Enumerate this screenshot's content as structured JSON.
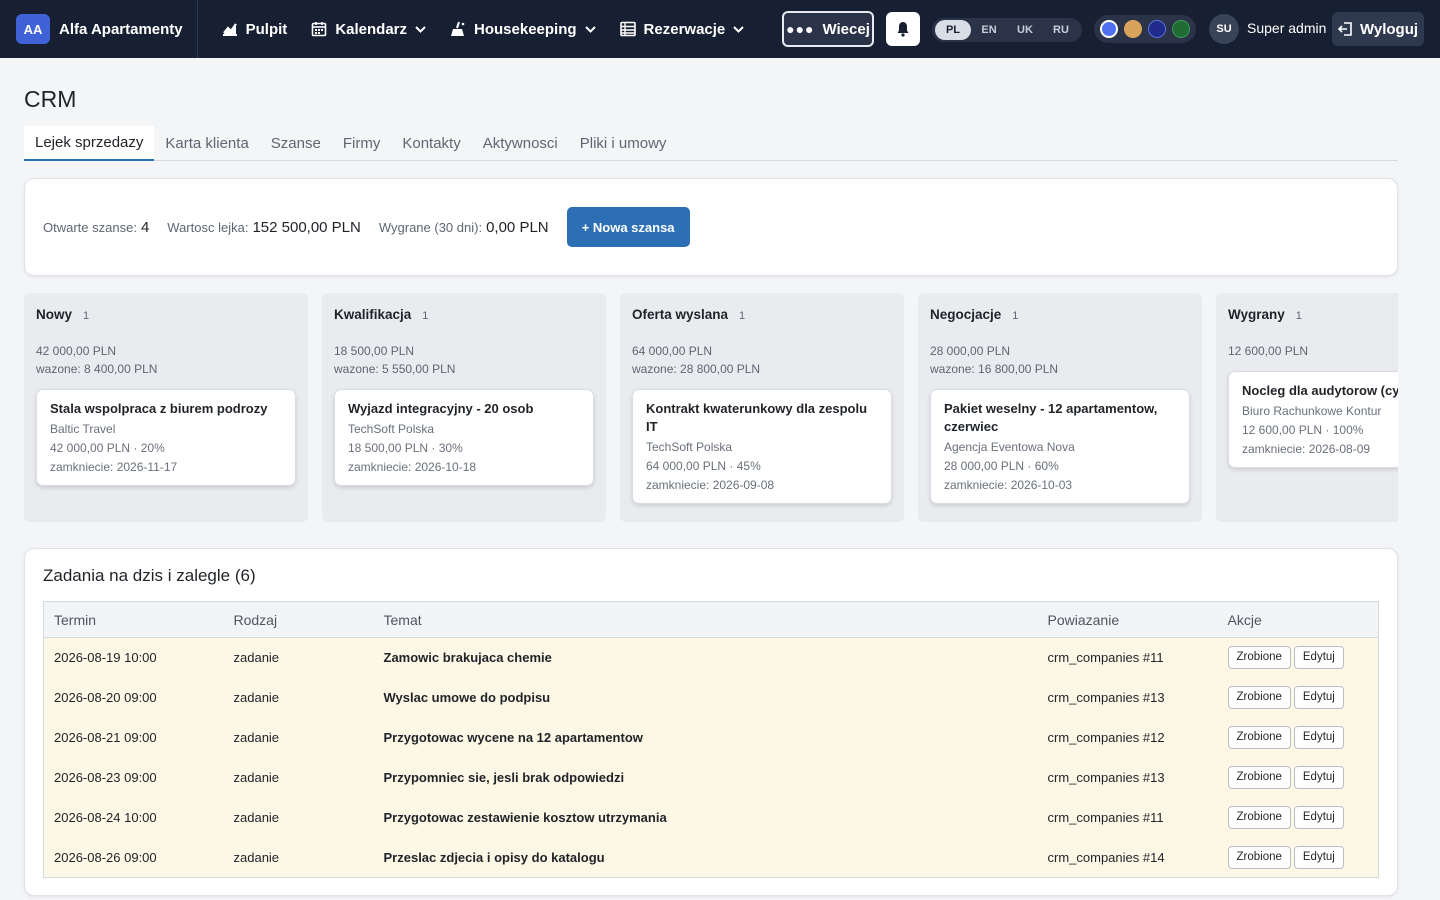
{
  "nav": {
    "brand_badge": "AA",
    "brand_name": "Alfa Apartamenty",
    "items": [
      {
        "label": "Pulpit",
        "icon": "chart-icon"
      },
      {
        "label": "Kalendarz",
        "icon": "calendar-icon"
      },
      {
        "label": "Housekeeping",
        "icon": "broom-icon"
      },
      {
        "label": "Rezerwacje",
        "icon": "list-icon"
      }
    ],
    "more_label": "Wiecej",
    "languages": [
      "PL",
      "EN",
      "UK",
      "RU"
    ],
    "active_language": "PL",
    "theme_colors": [
      "#4f6ff0",
      "#d9a35c",
      "#1f2a8a",
      "#1e6b34"
    ],
    "user_initials": "SU",
    "user_name": "Super admin",
    "logout_label": "Wyloguj"
  },
  "page": {
    "title": "CRM",
    "tabs": [
      "Lejek sprzedazy",
      "Karta klienta",
      "Szanse",
      "Firmy",
      "Kontakty",
      "Aktywnosci",
      "Pliki i umowy"
    ],
    "active_tab": "Lejek sprzedazy"
  },
  "stats": {
    "open_label": "Otwarte szanse:",
    "open_value": "4",
    "funnel_label": "Wartosc lejka:",
    "funnel_value": "152 500,00 PLN",
    "won_label": "Wygrane (30 dni):",
    "won_value": "0,00 PLN",
    "new_button": "+ Nowa szansa"
  },
  "kanban": [
    {
      "stage": "Nowy",
      "count": "1",
      "sum": "42 000,00 PLN",
      "weighted": "wazone: 8 400,00 PLN",
      "deals": [
        {
          "title": "Stala wspolpraca z biurem podrozy",
          "company": "Baltic Travel",
          "value": "42 000,00 PLN · 20%",
          "close": "zamkniecie: 2026-11-17"
        }
      ]
    },
    {
      "stage": "Kwalifikacja",
      "count": "1",
      "sum": "18 500,00 PLN",
      "weighted": "wazone: 5 550,00 PLN",
      "deals": [
        {
          "title": "Wyjazd integracyjny - 20 osob",
          "company": "TechSoft Polska",
          "value": "18 500,00 PLN · 30%",
          "close": "zamkniecie: 2026-10-18"
        }
      ]
    },
    {
      "stage": "Oferta wyslana",
      "count": "1",
      "sum": "64 000,00 PLN",
      "weighted": "wazone: 28 800,00 PLN",
      "deals": [
        {
          "title": "Kontrakt kwaterunkowy dla zespolu IT",
          "company": "TechSoft Polska",
          "value": "64 000,00 PLN · 45%",
          "close": "zamkniecie: 2026-09-08"
        }
      ]
    },
    {
      "stage": "Negocjacje",
      "count": "1",
      "sum": "28 000,00 PLN",
      "weighted": "wazone: 16 800,00 PLN",
      "deals": [
        {
          "title": "Pakiet weselny - 12 apartamentow, czerwiec",
          "company": "Agencja Eventowa Nova",
          "value": "28 000,00 PLN · 60%",
          "close": "zamkniecie: 2026-10-03"
        }
      ]
    },
    {
      "stage": "Wygrany",
      "count": "1",
      "sum": "12 600,00 PLN",
      "weighted": "",
      "deals": [
        {
          "title": "Nocleg dla audytorow (cyk",
          "company": "Biuro Rachunkowe Kontur",
          "value": "12 600,00 PLN · 100%",
          "close": "zamkniecie: 2026-08-09"
        }
      ]
    }
  ],
  "tasks": {
    "title": "Zadania na dzis i zalegle (6)",
    "columns": [
      "Termin",
      "Rodzaj",
      "Temat",
      "Powiazanie",
      "Akcje"
    ],
    "done_label": "Zrobione",
    "edit_label": "Edytuj",
    "rows": [
      {
        "due": "2026-08-19 10:00",
        "type": "zadanie",
        "subject": "Zamowic brakujaca chemie",
        "link": "crm_companies #11"
      },
      {
        "due": "2026-08-20 09:00",
        "type": "zadanie",
        "subject": "Wyslac umowe do podpisu",
        "link": "crm_companies #13"
      },
      {
        "due": "2026-08-21 09:00",
        "type": "zadanie",
        "subject": "Przygotowac wycene na 12 apartamentow",
        "link": "crm_companies #12"
      },
      {
        "due": "2026-08-23 09:00",
        "type": "zadanie",
        "subject": "Przypomniec sie, jesli brak odpowiedzi",
        "link": "crm_companies #13"
      },
      {
        "due": "2026-08-24 10:00",
        "type": "zadanie",
        "subject": "Przygotowac zestawienie kosztow utrzymania",
        "link": "crm_companies #11"
      },
      {
        "due": "2026-08-26 09:00",
        "type": "zadanie",
        "subject": "Przeslac zdjecia i opisy do katalogu",
        "link": "crm_companies #14"
      }
    ]
  }
}
